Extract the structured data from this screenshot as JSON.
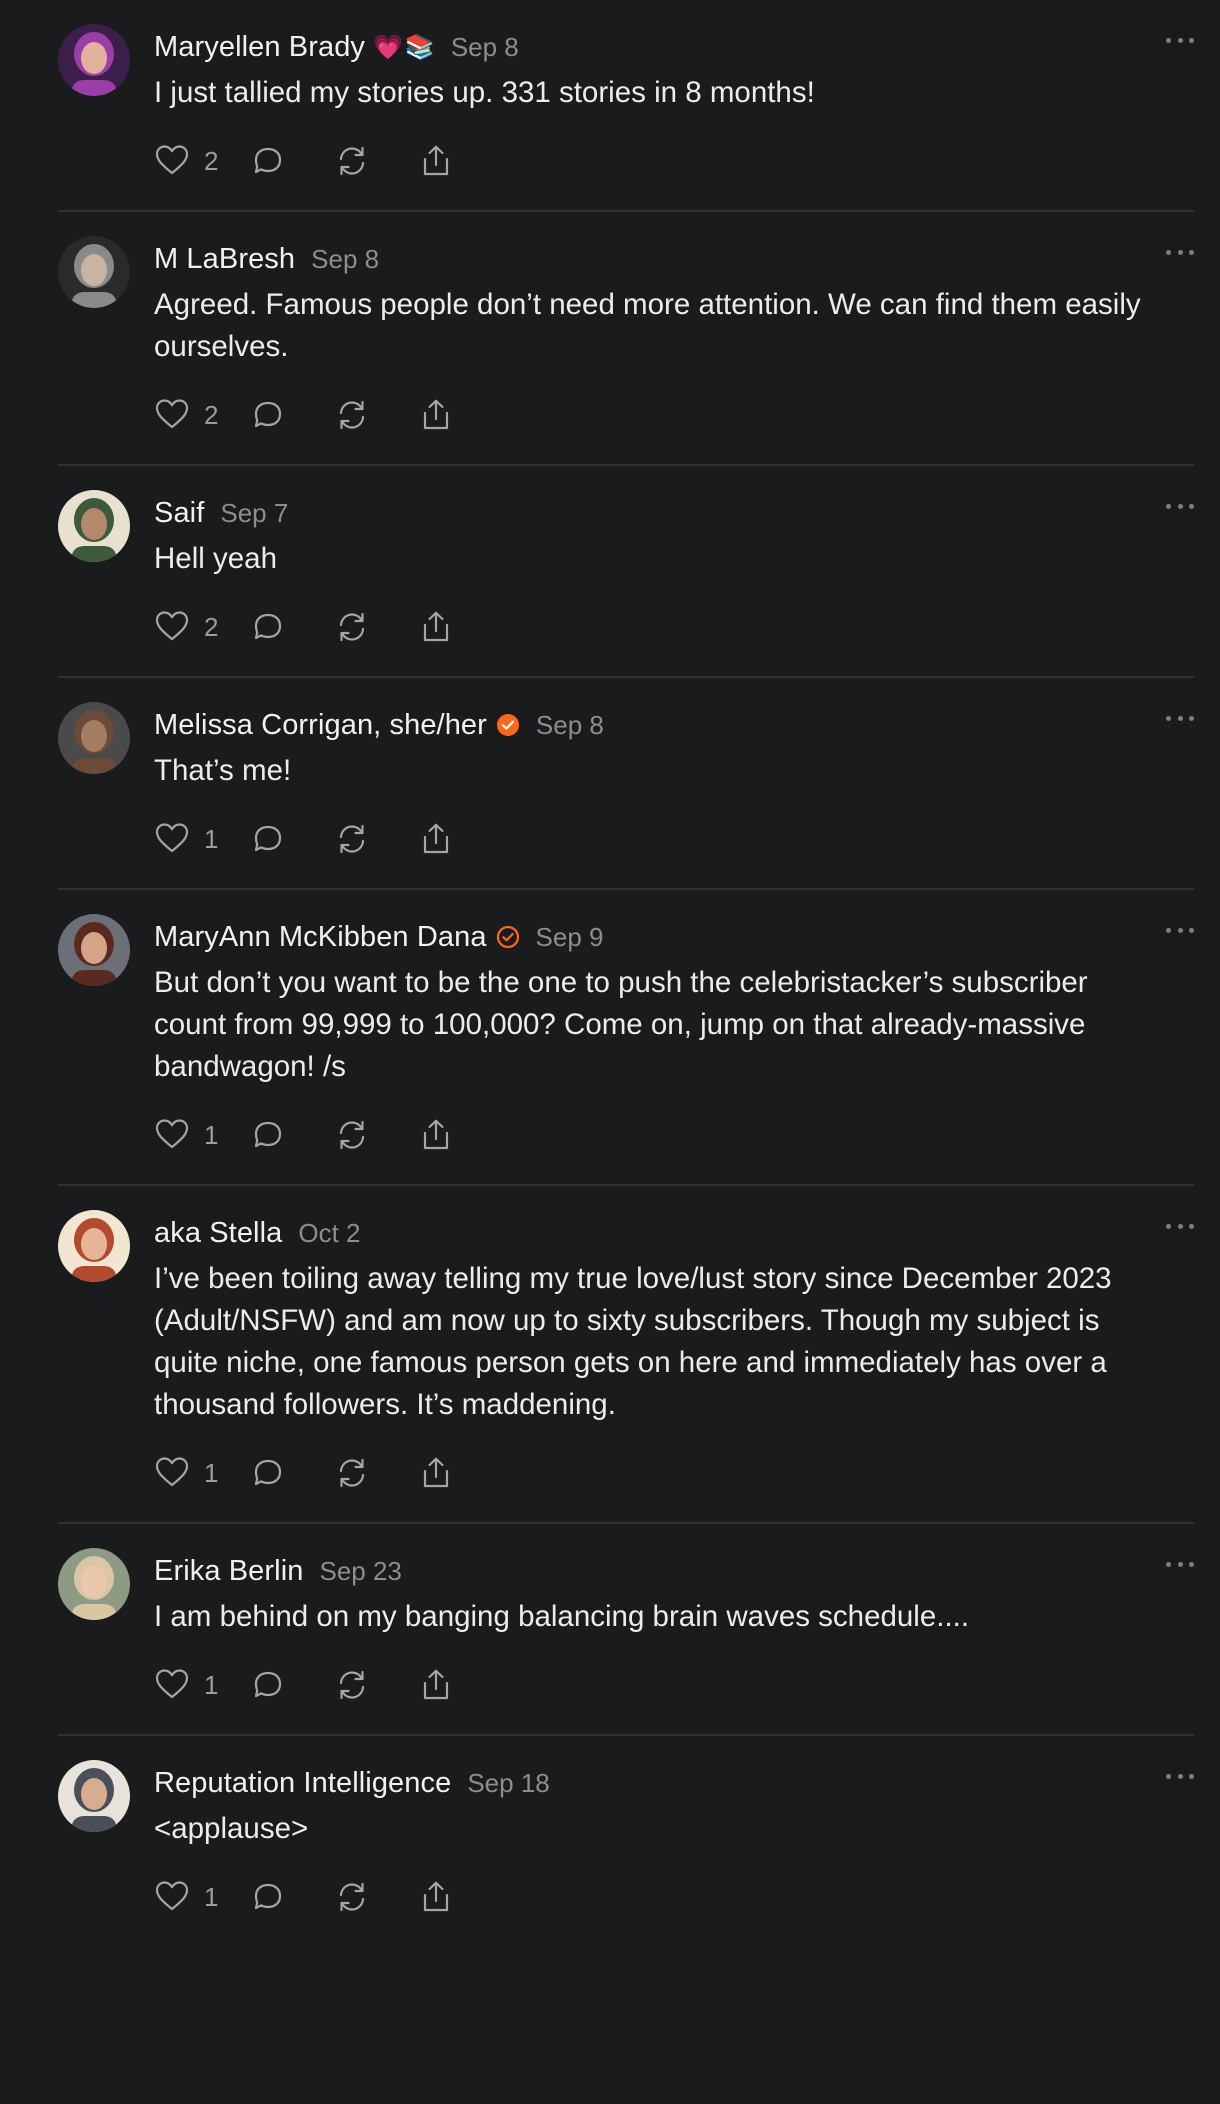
{
  "posts": [
    {
      "author": "Maryellen Brady",
      "emoji": [
        "💗",
        "📚"
      ],
      "verified": false,
      "date": "Sep 8",
      "text": "I just tallied my stories up. 331 stories in 8 months!",
      "likes": "2",
      "avatar_colors": [
        "#3b1f4a",
        "#9a3fa8",
        "#e1b39a"
      ]
    },
    {
      "author": "M LaBresh",
      "emoji": [],
      "verified": false,
      "date": "Sep 8",
      "text": "Agreed. Famous people don’t need more attention. We can find them easily ourselves.",
      "likes": "2",
      "avatar_colors": [
        "#2b2a2a",
        "#8a8a8a",
        "#c9b3a3"
      ]
    },
    {
      "author": "Saif",
      "emoji": [],
      "verified": false,
      "date": "Sep 7",
      "text": "Hell yeah",
      "likes": "2",
      "avatar_colors": [
        "#e9e1cf",
        "#3d5a3b",
        "#b48a6a"
      ]
    },
    {
      "author": "Melissa Corrigan, she/her",
      "emoji": [],
      "verified": true,
      "verified_style": "filled",
      "date": "Sep 8",
      "text": "That’s me!",
      "likes": "1",
      "avatar_colors": [
        "#4a4a4a",
        "#6b4a3a",
        "#a47c5f"
      ]
    },
    {
      "author": "MaryAnn McKibben Dana",
      "emoji": [],
      "verified": true,
      "verified_style": "outline",
      "date": "Sep 9",
      "text": "But don’t you want to be the one to push the celebristacker’s subscriber count from 99,999 to 100,000? Come on, jump on that already-massive bandwagon! /s",
      "likes": "1",
      "avatar_colors": [
        "#6b6f78",
        "#5a2a20",
        "#d5a486"
      ]
    },
    {
      "author": "aka Stella",
      "emoji": [],
      "verified": false,
      "date": "Oct 2",
      "text": "I’ve been toiling away telling my true love/lust story since December 2023 (Adult/NSFW) and am now up to sixty subscribers. Though my subject is quite niche, one famous person gets on here and immediately has over a thousand followers. It’s maddening.",
      "likes": "1",
      "avatar_colors": [
        "#f2e6d2",
        "#b24a2e",
        "#e6b496"
      ]
    },
    {
      "author": "Erika Berlin",
      "emoji": [],
      "verified": false,
      "date": "Sep 23",
      "text": "I am behind on my banging balancing brain waves schedule....",
      "likes": "1",
      "avatar_colors": [
        "#8d9a84",
        "#d9c6a4",
        "#e9c8ae"
      ]
    },
    {
      "author": "Reputation Intelligence",
      "emoji": [],
      "verified": false,
      "date": "Sep 18",
      "text": "<applause>",
      "likes": "1",
      "avatar_colors": [
        "#e7e3da",
        "#4a4f5a",
        "#d7ad90"
      ]
    }
  ],
  "accent_color": "#ff6719"
}
